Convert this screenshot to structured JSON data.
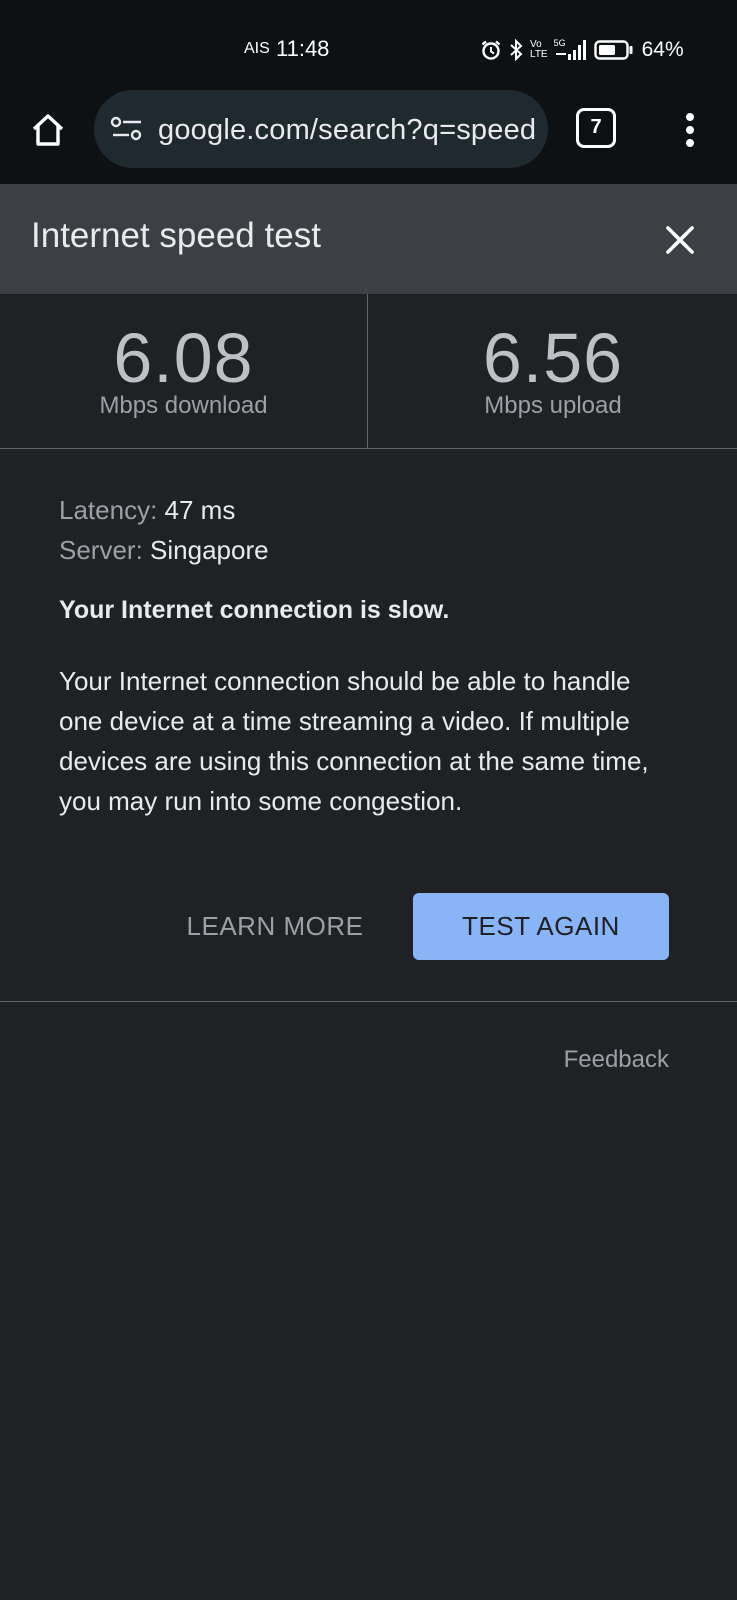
{
  "status_bar": {
    "carrier": "AIS",
    "time": "11:48",
    "icons": [
      "alarm-icon",
      "bluetooth-icon",
      "volte-icon",
      "signal-5g-icon",
      "battery-icon"
    ],
    "volte_top": "Vo",
    "volte_bottom": "LTE",
    "network_label": "5G",
    "battery_level": 0.64,
    "battery_text": "64%"
  },
  "browser": {
    "url": "google.com/search?q=speed+test",
    "tab_count": "7",
    "icons": {
      "home": "home-icon",
      "site_settings": "tune-icon",
      "menu": "more-vert-icon"
    }
  },
  "panel": {
    "title": "Internet speed test",
    "close_icon": "close-icon"
  },
  "metrics": {
    "download": {
      "value": "6.08",
      "label": "Mbps download"
    },
    "upload": {
      "value": "6.56",
      "label": "Mbps upload"
    }
  },
  "details": {
    "latency_label": "Latency:",
    "latency_value": "47 ms",
    "server_label": "Server:",
    "server_value": "Singapore"
  },
  "result": {
    "heading": "Your Internet connection is slow.",
    "description": "Your Internet connection should be able to handle one device at a time streaming a video. If multiple devices are using this connection at the same time, you may run into some congestion."
  },
  "actions": {
    "learn_more": "LEARN MORE",
    "test_again": "TEST AGAIN"
  },
  "footer": {
    "feedback": "Feedback"
  },
  "colors": {
    "background": "#202124",
    "status_bar": "#0e1114",
    "omnibox": "#1f2a30",
    "header": "#3c3f43",
    "accent": "#8ab4f8",
    "secondary_text": "#9aa0a6"
  }
}
